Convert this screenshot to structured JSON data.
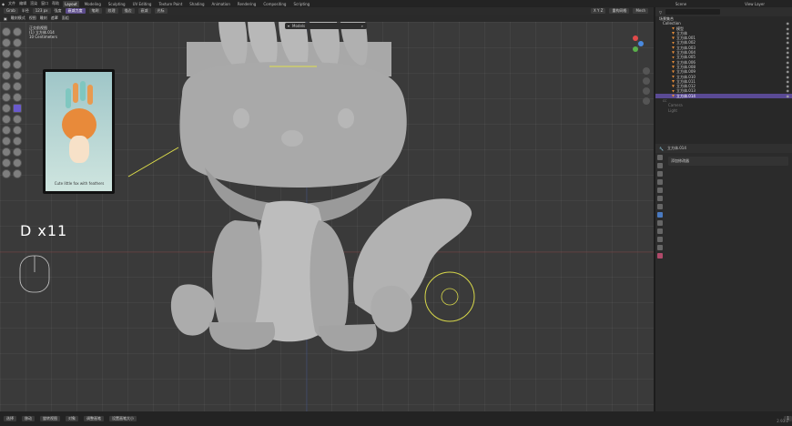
{
  "topbar": {
    "menus": [
      "文件",
      "编辑",
      "渲染",
      "窗口",
      "帮助"
    ],
    "workspaces": [
      "Layout",
      "Modeling",
      "Sculpting",
      "UV Editing",
      "Texture Paint",
      "Shading",
      "Animation",
      "Rendering",
      "Compositing",
      "Scripting"
    ],
    "active_workspace": "Layout",
    "scene": "Scene",
    "view_layer": "View Layer"
  },
  "header": {
    "brush": "Grab",
    "radius_label": "半径",
    "radius_value": "123 px",
    "strength_label": "强度",
    "falloff_chip": "衰减力度",
    "options": [
      "笔刷",
      "纹理",
      "描边",
      "衰减",
      "光标"
    ],
    "symmetry": "X Y Z",
    "remesh": "重构网格",
    "mode": "Mesh"
  },
  "tool_header": {
    "mode_label": "雕刻模式",
    "view": "视图",
    "sculpt": "雕刻",
    "mask": "遮罩",
    "face_sets": "面组"
  },
  "viewport": {
    "info_line1": "正交前视图",
    "info_line2": "(1) 立方体.014",
    "info_line3": "10 Centimeters",
    "key_display": "D x11",
    "mode_chip": "Models"
  },
  "reference": {
    "caption": "Cute little fox with feathers"
  },
  "outliner": {
    "title": "场景集合",
    "collection": "Collection",
    "items": [
      {
        "name": "模型",
        "selected": false
      },
      {
        "name": "立方体",
        "selected": false
      },
      {
        "name": "立方体.001",
        "selected": false
      },
      {
        "name": "立方体.002",
        "selected": false
      },
      {
        "name": "立方体.003",
        "selected": false
      },
      {
        "name": "立方体.004",
        "selected": false
      },
      {
        "name": "立方体.005",
        "selected": false
      },
      {
        "name": "立方体.006",
        "selected": false
      },
      {
        "name": "立方体.008",
        "selected": false
      },
      {
        "name": "立方体.009",
        "selected": false
      },
      {
        "name": "立方体.010",
        "selected": false
      },
      {
        "name": "立方体.011",
        "selected": false
      },
      {
        "name": "立方体.012",
        "selected": false
      },
      {
        "name": "立方体.013",
        "selected": false
      },
      {
        "name": "立方体.014",
        "selected": true
      }
    ],
    "extra": [
      "cc",
      "Camera",
      "Light"
    ]
  },
  "properties": {
    "header": "立方体.014",
    "field": "添加修改器"
  },
  "statusbar": {
    "items": [
      "选择",
      "移动",
      "旋转视图",
      "对象",
      "调整画笔",
      "设置画笔大小"
    ],
    "frame": "1",
    "version": "2.93.2"
  },
  "colors": {
    "selection": "#5a4a94",
    "accent": "#6a5acd",
    "guide_line": "#e0e04a"
  }
}
